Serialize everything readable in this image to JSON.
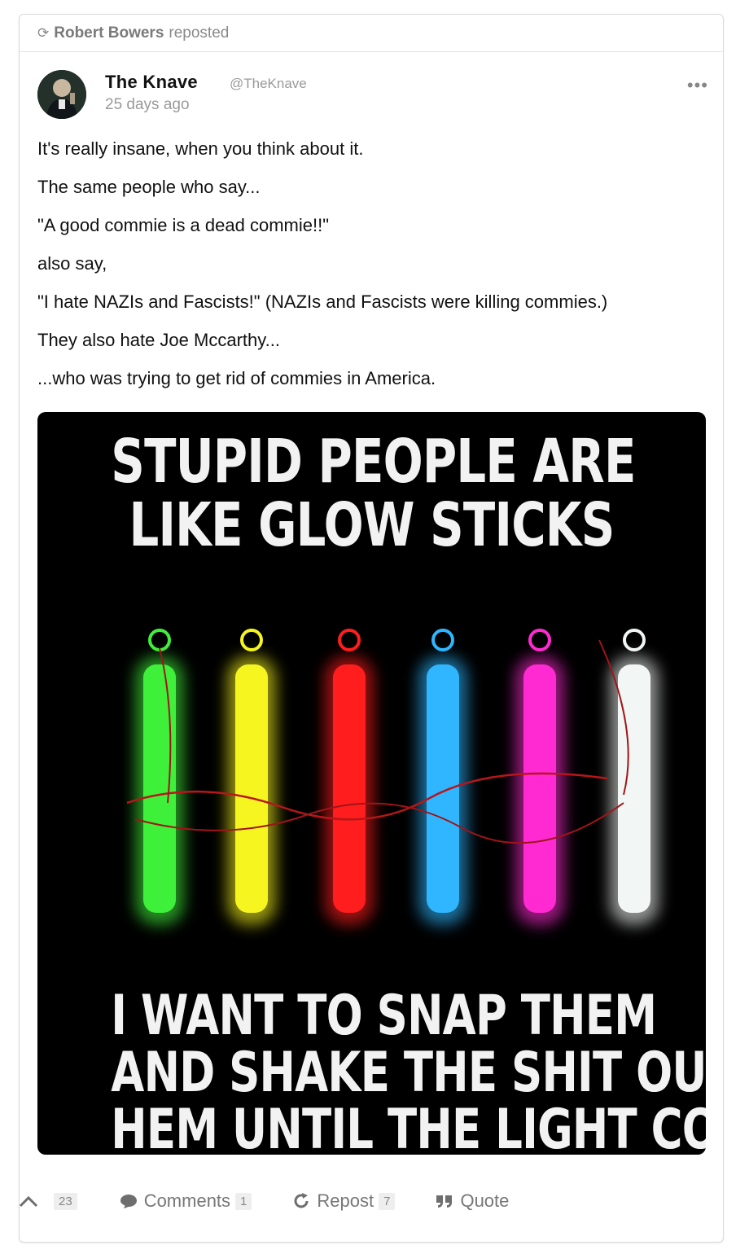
{
  "repost": {
    "user": "Robert Bowers",
    "action": "reposted"
  },
  "author": {
    "name": "The Knave",
    "handle": "@TheKnave",
    "time": "25 days ago"
  },
  "post": {
    "lines": [
      "It's really insane, when you think about it.",
      "The same people who say...",
      "\"A good commie is a dead commie!!\"",
      "also say,",
      "\"I hate NAZIs and Fascists!\" (NAZIs and Fascists were killing commies.)",
      "They also hate Joe Mccarthy...",
      "...who was trying to get rid of commies in America."
    ]
  },
  "media": {
    "top_text": [
      "STUPID PEOPLE ARE",
      "LIKE GLOW STICKS"
    ],
    "bottom_text": [
      "I WANT TO SNAP THEM",
      "AND SHAKE THE SHIT OUT OF",
      "HEM UNTIL THE LIGHT COMES ON"
    ],
    "stick_colors": [
      "#3ff03a",
      "#f7f51f",
      "#ff1d1d",
      "#2fb6ff",
      "#ff2ad2",
      "#f2f6f4"
    ]
  },
  "footer": {
    "upvote_count": "23",
    "comments_label": "Comments",
    "comments_count": "1",
    "repost_label": "Repost",
    "repost_count": "7",
    "quote_label": "Quote"
  },
  "more_label": "•••"
}
